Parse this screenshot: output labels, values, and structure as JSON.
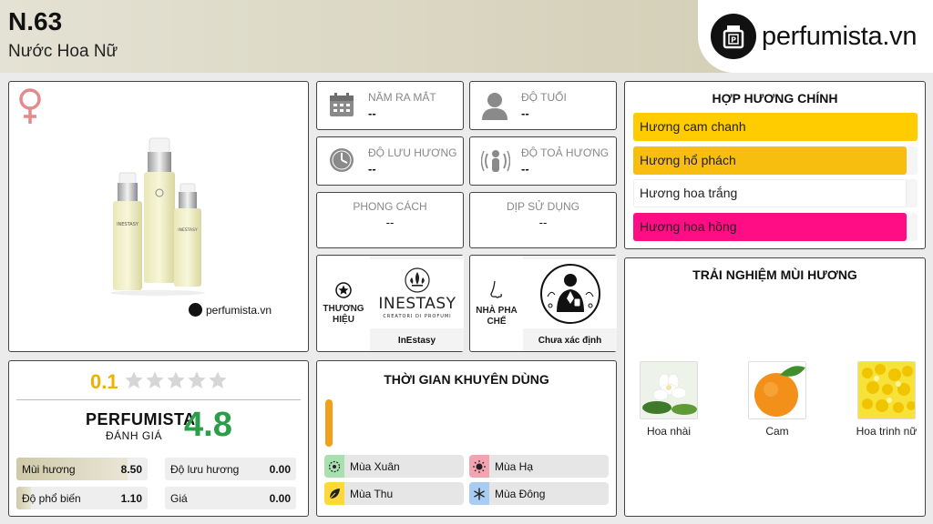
{
  "header": {
    "title": "N.63",
    "subtitle": "Nước Hoa Nữ",
    "logo_text": "perfumista.vn"
  },
  "image_panel": {
    "gender_icon": "female-symbol-icon",
    "watermark": "perfumista.vn"
  },
  "info": {
    "release_year": {
      "label": "NĂM RA MẮT",
      "value": "--",
      "icon": "calendar-icon"
    },
    "age": {
      "label": "ĐỘ TUỔI",
      "value": "--",
      "icon": "person-icon"
    },
    "longevity": {
      "label": "ĐỘ LƯU HƯƠNG",
      "value": "--",
      "icon": "clock-icon"
    },
    "sillage": {
      "label": "ĐỘ TOẢ HƯƠNG",
      "value": "--",
      "icon": "radiate-icon"
    },
    "style": {
      "label": "PHONG CÁCH",
      "value": "--"
    },
    "occasion": {
      "label": "DỊP SỬ DỤNG",
      "value": "--"
    }
  },
  "brand": {
    "side_label": "THƯƠNG HIỆU",
    "logo_main": "INESTASY",
    "logo_sub": "CREATORI DI PROFUMI",
    "name": "InEstasy"
  },
  "perfumer": {
    "side_label": "NHÀ PHA CHẾ",
    "name": "Chưa xác định"
  },
  "accords": {
    "title": "HỢP HƯƠNG CHÍNH",
    "items": [
      {
        "name": "Hương cam chanh",
        "level": 1.0,
        "color": "#ffcc00"
      },
      {
        "name": "Hương hổ phách",
        "level": 0.96,
        "color": "#f7bd0f"
      },
      {
        "name": "Hương hoa trắng",
        "level": 0.96,
        "color": "#ffffff"
      },
      {
        "name": "Hương hoa hồng",
        "level": 0.96,
        "color": "#ff0d84"
      }
    ]
  },
  "notes": {
    "title": "TRẢI NGHIỆM MÙI HƯƠNG",
    "items": [
      {
        "name": "Hoa nhài"
      },
      {
        "name": "Cam"
      },
      {
        "name": "Hoa trinh nữ"
      }
    ]
  },
  "rating": {
    "user_score": "0.1",
    "stars_filled": 0,
    "stars_total": 5,
    "perfumista_label": "PERFUMISTA",
    "perfumista_sub": "ĐÁNH GIÁ",
    "perfumista_score": "4.8",
    "metrics": [
      {
        "label": "Mùi hương",
        "value": "8.50",
        "level": 0.85
      },
      {
        "label": "Độ lưu hương",
        "value": "0.00",
        "level": 0.0
      },
      {
        "label": "Độ phổ biến",
        "value": "1.10",
        "level": 0.11
      },
      {
        "label": "Giá",
        "value": "0.00",
        "level": 0.0
      }
    ]
  },
  "time": {
    "title": "THỜI GIAN KHUYÊN DÙNG",
    "seasons": [
      {
        "label": "Mùa Xuân",
        "color": "#a8e0b0",
        "icon": "spring-icon"
      },
      {
        "label": "Mùa Hạ",
        "color": "#f4a3b0",
        "icon": "sun-icon"
      },
      {
        "label": "Mùa Thu",
        "color": "#ffd83a",
        "icon": "leaf-icon"
      },
      {
        "label": "Mùa Đông",
        "color": "#a9cdf2",
        "icon": "snowflake-icon"
      }
    ]
  }
}
